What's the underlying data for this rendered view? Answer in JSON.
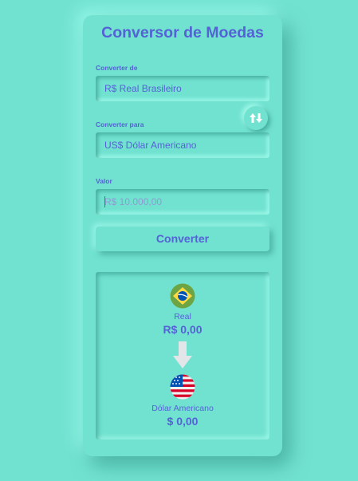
{
  "app": {
    "title": "Conversor de Moedas"
  },
  "from": {
    "label": "Converter de",
    "value": "R$ Real Brasileiro"
  },
  "to": {
    "label": "Converter para",
    "value": "US$ Dólar Americano"
  },
  "amount": {
    "label": "Valor",
    "placeholder": "R$ 10.000,00",
    "value": ""
  },
  "actions": {
    "convert_label": "Converter",
    "swap_icon": "swap-vertical-icon"
  },
  "result": {
    "source": {
      "name": "Real",
      "value": "R$ 0,00",
      "flag": "brazil-flag-icon"
    },
    "target": {
      "name": "Dólar Americano",
      "value": "$ 0,00",
      "flag": "usa-flag-icon"
    },
    "arrow_icon": "arrow-down-icon"
  },
  "colors": {
    "background": "#72e2d0",
    "accent": "#5462d6",
    "placeholder": "#8e9ad4"
  }
}
